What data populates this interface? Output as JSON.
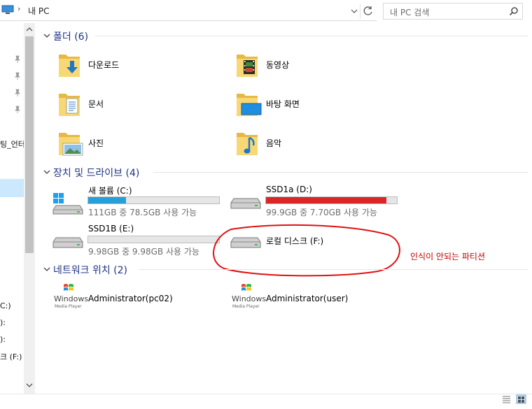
{
  "address": {
    "crumb": "내 PC",
    "separator": "›"
  },
  "search": {
    "placeholder": "내 PC 검색"
  },
  "nav": {
    "pinned_label_partial": "팅_언터",
    "drive_labels": [
      "C:)",
      "):",
      "):",
      "크 (F:)"
    ]
  },
  "sections": {
    "folders": {
      "title": "폴더 (6)"
    },
    "drives": {
      "title": "장치 및 드라이브 (4)"
    },
    "network": {
      "title": "네트워크 위치 (2)"
    }
  },
  "folders": [
    {
      "label": "다운로드",
      "icon": "downloads-folder-icon"
    },
    {
      "label": "동영상",
      "icon": "videos-folder-icon"
    },
    {
      "label": "문서",
      "icon": "documents-folder-icon"
    },
    {
      "label": "바탕 화면",
      "icon": "desktop-folder-icon"
    },
    {
      "label": "사진",
      "icon": "pictures-folder-icon"
    },
    {
      "label": "음악",
      "icon": "music-folder-icon"
    }
  ],
  "drives": [
    {
      "label": "새 볼륨 (C:)",
      "sub": "111GB 중 78.5GB 사용 가능",
      "used_fraction": 0.29,
      "bar_color": "#26a0da",
      "os_drive": true
    },
    {
      "label": "SSD1a (D:)",
      "sub": "99.9GB 중 7.70GB 사용 가능",
      "used_fraction": 0.92,
      "bar_color": "#da2626"
    },
    {
      "label": "SSD1B (E:)",
      "sub": "9.98GB 중 9.98GB 사용 가능",
      "used_fraction": 0.0,
      "bar_color": "#26a0da"
    },
    {
      "label": "로컬 디스크 (F:)",
      "sub": "",
      "used_fraction": null
    }
  ],
  "network": [
    {
      "label": "Administrator(pc02)",
      "icon_text": "Windows",
      "icon_sub": "Media Player"
    },
    {
      "label": "Administrator(user)",
      "icon_text": "Windows",
      "icon_sub": "Media Player"
    }
  ],
  "annotation": {
    "text": "인식이 안되는 파티션",
    "color": "#c00000"
  },
  "colors": {
    "accent": "#26a0da",
    "section_title": "#1e3287",
    "selection": "#cce8ff"
  }
}
